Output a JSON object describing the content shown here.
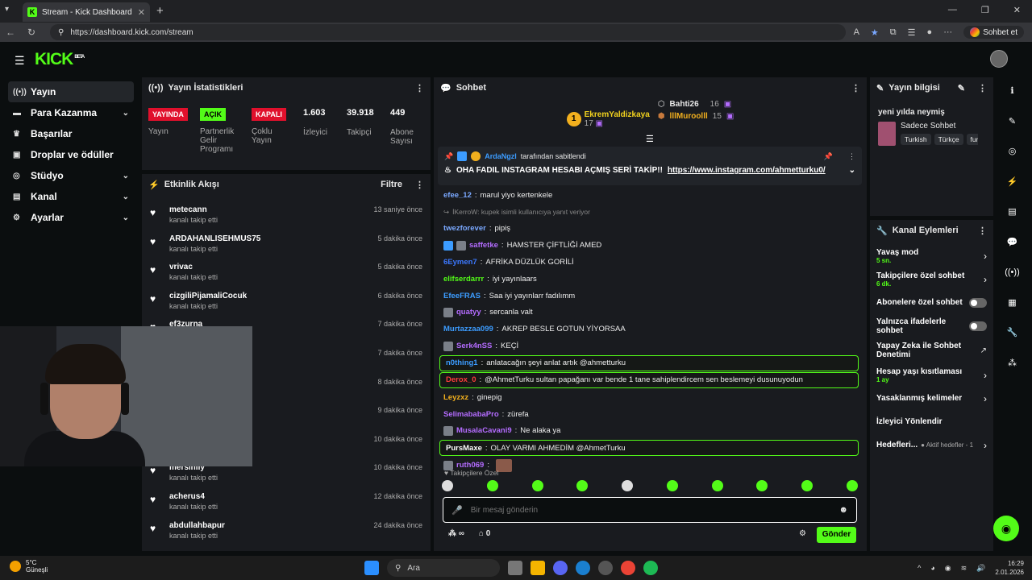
{
  "browser": {
    "tab_title": "Stream - Kick Dashboard",
    "url": "https://dashboard.kick.com/stream",
    "chat_button": "Sohbet et"
  },
  "app": {
    "logo": "KICK",
    "logo_badge": "BETA"
  },
  "sidebar": {
    "items": [
      {
        "label": "Yayın",
        "icon": "broadcast-icon"
      },
      {
        "label": "Para Kazanma",
        "icon": "wallet-icon"
      },
      {
        "label": "Başarılar",
        "icon": "trophy-icon"
      },
      {
        "label": "Droplar ve ödüller",
        "icon": "gift-icon"
      },
      {
        "label": "Stüdyo",
        "icon": "studio-icon"
      },
      {
        "label": "Kanal",
        "icon": "channel-icon"
      },
      {
        "label": "Ayarlar",
        "icon": "gear-icon"
      }
    ]
  },
  "stats_panel": {
    "title": "Yayın İstatistikleri",
    "stats": [
      {
        "badge": "YAYINDA",
        "label": "Yayın"
      },
      {
        "badge": "AÇIK",
        "label": "Partnerlik Gelir Programı"
      },
      {
        "badge": "KAPALI",
        "label": "Çoklu Yayın"
      },
      {
        "value": "1.603",
        "label": "İzleyici"
      },
      {
        "value": "39.918",
        "label": "Takipçi"
      },
      {
        "value": "449",
        "label": "Abone Sayısı"
      }
    ]
  },
  "activity": {
    "title": "Etkinlik Akışı",
    "filter": "Filtre",
    "items": [
      {
        "name": "metecann",
        "sub": "kanalı takip etti",
        "time": "13 saniye önce"
      },
      {
        "name": "ARDAHANLISEHMUS75",
        "sub": "kanalı takip etti",
        "time": "5 dakika önce"
      },
      {
        "name": "vrivac",
        "sub": "kanalı takip etti",
        "time": "5 dakika önce"
      },
      {
        "name": "cizgiliPijamaliCocuk",
        "sub": "kanalı takip etti",
        "time": "6 dakika önce"
      },
      {
        "name": "ef3zurna",
        "sub": "kanalı takip etti",
        "time": "7 dakika önce"
      },
      {
        "name": "",
        "sub": "",
        "time": "7 dakika önce"
      },
      {
        "name": "",
        "sub": "",
        "time": "8 dakika önce"
      },
      {
        "name": "",
        "sub": "",
        "time": "9 dakika önce"
      },
      {
        "name": "",
        "sub": "",
        "time": "10 dakika önce"
      },
      {
        "name": "mersinliy",
        "sub": "kanalı takip etti",
        "time": "10 dakika önce"
      },
      {
        "name": "acherus4",
        "sub": "kanalı takip etti",
        "time": "12 dakika önce"
      },
      {
        "name": "abdullahbapur",
        "sub": "kanalı takip etti",
        "time": "24 dakika önce"
      }
    ]
  },
  "chat": {
    "title": "Sohbet",
    "top_chatters": [
      {
        "rank": "1",
        "name": "EkremYaldizkaya",
        "count": "17"
      },
      {
        "name": "Bahti26",
        "count": "16"
      },
      {
        "name": "lllMuroolll",
        "count": "15"
      }
    ],
    "pinned_by": "ArdaNgzl",
    "pinned_suffix": "tarafından sabitlendi",
    "pinned_text": "OHA FADIL INSTAGRAM HESABI AÇMIŞ SERİ TAKİP!!",
    "pinned_link": "https://www.instagram.com/ahmetturku0/",
    "messages": [
      {
        "user": "efee_12",
        "text": "marul yiyo kertenkele",
        "color": "#7aa8ff"
      },
      {
        "user": "",
        "text": "İKerroW: kupek isimli kullanıcıya yanıt veriyor",
        "color": "#888888",
        "reply": true
      },
      {
        "user": "twezforever",
        "text": "pipiş",
        "color": "#7aa8ff"
      },
      {
        "user": "saffetke",
        "text": "HAMSTER ÇİFTLİĞİ AMED",
        "color": "#b46cff"
      },
      {
        "user": "6Eymen7",
        "text": "AFRİKA DÜZLÜK GORİLİ",
        "color": "#3c78ff"
      },
      {
        "user": "elifserdarrr",
        "text": "iyi yayınlaars",
        "color": "#53fc18"
      },
      {
        "user": "EfeeFRAS",
        "text": "Saa iyi yayınlarr fadılımm",
        "color": "#3c9cff"
      },
      {
        "user": "quatyy",
        "text": "sercanla valt",
        "color": "#b46cff"
      },
      {
        "user": "Murtazzaa099",
        "text": "AKREP BESLE GOTUN YİYORSAA",
        "color": "#3c9cff"
      },
      {
        "user": "Serk4nSS",
        "text": "KEÇİ",
        "color": "#b46cff"
      },
      {
        "user": "n0thing1",
        "text": "anlatacağın şeyi anlat artık @ahmetturku",
        "color": "#3c9cff",
        "hl": true
      },
      {
        "user": "Derox_0",
        "text": "@AhmetTurku sultan papağanı var bende 1 tane sahiplendircem sen beslemeyi dusunuyodun",
        "color": "#ff3c3c",
        "hl": true
      },
      {
        "user": "Leyzxz",
        "text": "ginepig",
        "color": "#f2b01e"
      },
      {
        "user": "SelimababaPro",
        "text": "zürefa",
        "color": "#b46cff"
      },
      {
        "user": "MusalaCavani9",
        "text": "Ne alaka ya",
        "color": "#b46cff"
      },
      {
        "user": "PursMaxe",
        "text": "OLAY VARMI AHMEDİM @AhmetTurku",
        "color": "#ffffff",
        "hl": true
      },
      {
        "user": "ruth069",
        "text": "",
        "color": "#b46cff"
      }
    ],
    "followers_only_label": "Takipçilere Özel",
    "input_placeholder": "Bir mesaj gönderin",
    "points": "∞",
    "gifts": "0",
    "send_label": "Gönder"
  },
  "stream_info": {
    "title": "Yayın bilgisi",
    "stream_title": "yeni yılda neymiş",
    "category": "Sadece Sohbet",
    "tags": [
      "Turkish",
      "Türkçe",
      "fun"
    ]
  },
  "channel_actions": {
    "title": "Kanal Eylemleri",
    "items": [
      {
        "label": "Yavaş mod",
        "sub": "5 sn.",
        "kind": "arrow"
      },
      {
        "label": "Takipçilere özel sohbet",
        "sub": "6 dk.",
        "kind": "arrow"
      },
      {
        "label": "Abonelere özel sohbet",
        "sub": "",
        "kind": "toggle"
      },
      {
        "label": "Yalnızca ifadelerle sohbet",
        "sub": "",
        "kind": "toggle"
      },
      {
        "label": "Yapay Zeka ile Sohbet Denetimi",
        "sub": "",
        "kind": "external"
      },
      {
        "label": "Hesap yaşı kısıtlaması",
        "sub": "1 ay",
        "kind": "arrow"
      },
      {
        "label": "Yasaklanmış kelimeler",
        "sub": "",
        "kind": "arrow"
      },
      {
        "label": "İzleyici Yönlendir",
        "sub": "",
        "kind": "none"
      },
      {
        "label": "Hedefleri...",
        "sub": "Aktif hedefler - 1",
        "kind": "arrow"
      }
    ]
  },
  "taskbar": {
    "temp": "5°C",
    "weather": "Güneşli",
    "search": "Ara",
    "time": "16:29",
    "date": "2.01.2026"
  }
}
